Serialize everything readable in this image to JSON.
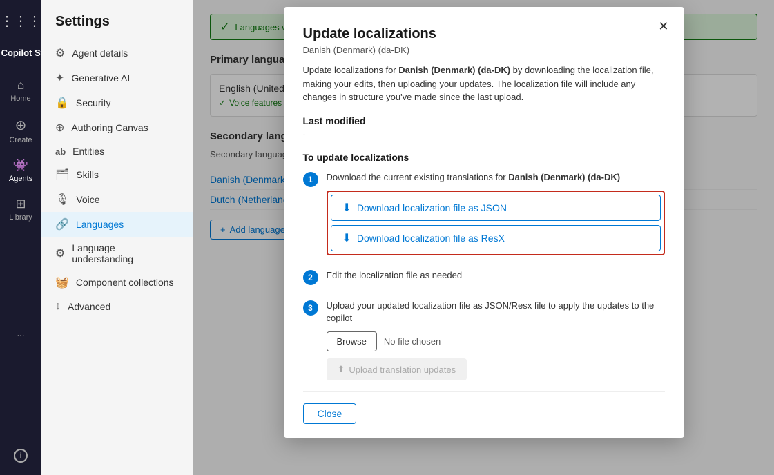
{
  "app": {
    "name": "Copilot Studio",
    "nav_dots_icon": "⋮⋮⋮"
  },
  "nav": {
    "items": [
      {
        "id": "home",
        "label": "Home",
        "icon": "⌂",
        "active": false
      },
      {
        "id": "create",
        "label": "Create",
        "icon": "+",
        "active": false
      },
      {
        "id": "agents",
        "label": "Agents",
        "icon": "🤖",
        "active": true
      },
      {
        "id": "library",
        "label": "Library",
        "icon": "⊞",
        "active": false
      }
    ],
    "more_icon": "···",
    "info_icon": "ℹ"
  },
  "sidebar": {
    "title": "Settings",
    "items": [
      {
        "id": "agent-details",
        "label": "Agent details",
        "icon": "⚙",
        "active": false
      },
      {
        "id": "generative-ai",
        "label": "Generative AI",
        "icon": "✦",
        "active": false
      },
      {
        "id": "security",
        "label": "Security",
        "icon": "🔒",
        "active": false
      },
      {
        "id": "authoring-canvas",
        "label": "Authoring Canvas",
        "icon": "⊕",
        "active": false
      },
      {
        "id": "entities",
        "label": "Entities",
        "icon": "ab",
        "active": false
      },
      {
        "id": "skills",
        "label": "Skills",
        "icon": "🗂",
        "active": false
      },
      {
        "id": "voice",
        "label": "Voice",
        "icon": "🎙",
        "active": false
      },
      {
        "id": "languages",
        "label": "Languages",
        "icon": "🔗",
        "active": true
      },
      {
        "id": "language-understanding",
        "label": "Language understanding",
        "icon": "⚙",
        "active": false
      },
      {
        "id": "component-collections",
        "label": "Component collections",
        "icon": "🧺",
        "active": false
      },
      {
        "id": "advanced",
        "label": "Advanced",
        "icon": "↕",
        "active": false
      }
    ]
  },
  "page": {
    "success_banner": "Languages were added",
    "primary_language_title": "Primary language",
    "primary_language_name": "English (United States) (e...",
    "voice_supported": "Voice features supported",
    "secondary_languages_title": "Secondary languages",
    "secondary_col_header": "Secondary language ↑",
    "languages": [
      {
        "name": "Danish (Denmark) (da-DK)"
      },
      {
        "name": "Dutch (Netherlands) (nl-NL..."
      }
    ],
    "add_language_label": "Add language"
  },
  "modal": {
    "title": "Update localizations",
    "subtitle": "Danish (Denmark) (da-DK)",
    "description_part1": "Update localizations for ",
    "description_bold": "Danish (Denmark) (da-DK)",
    "description_part2": " by downloading the localization file, making your edits, then uploading your updates. The localization file will include any changes in structure you've made since the last upload.",
    "last_modified_label": "Last modified",
    "last_modified_value": "-",
    "to_update_label": "To update localizations",
    "step1_text_part1": "Download the current existing translations for ",
    "step1_text_bold": "Danish (Denmark) (da-DK)",
    "download_json_label": "Download localization file as JSON",
    "download_resx_label": "Download localization file as ResX",
    "step2_text": "Edit the localization file as needed",
    "step3_text": "Upload your updated localization file as JSON/Resx file to apply the updates to the copilot",
    "browse_label": "Browse",
    "no_file_label": "No file chosen",
    "upload_label": "Upload translation updates",
    "close_label": "Close",
    "close_icon": "✕"
  }
}
